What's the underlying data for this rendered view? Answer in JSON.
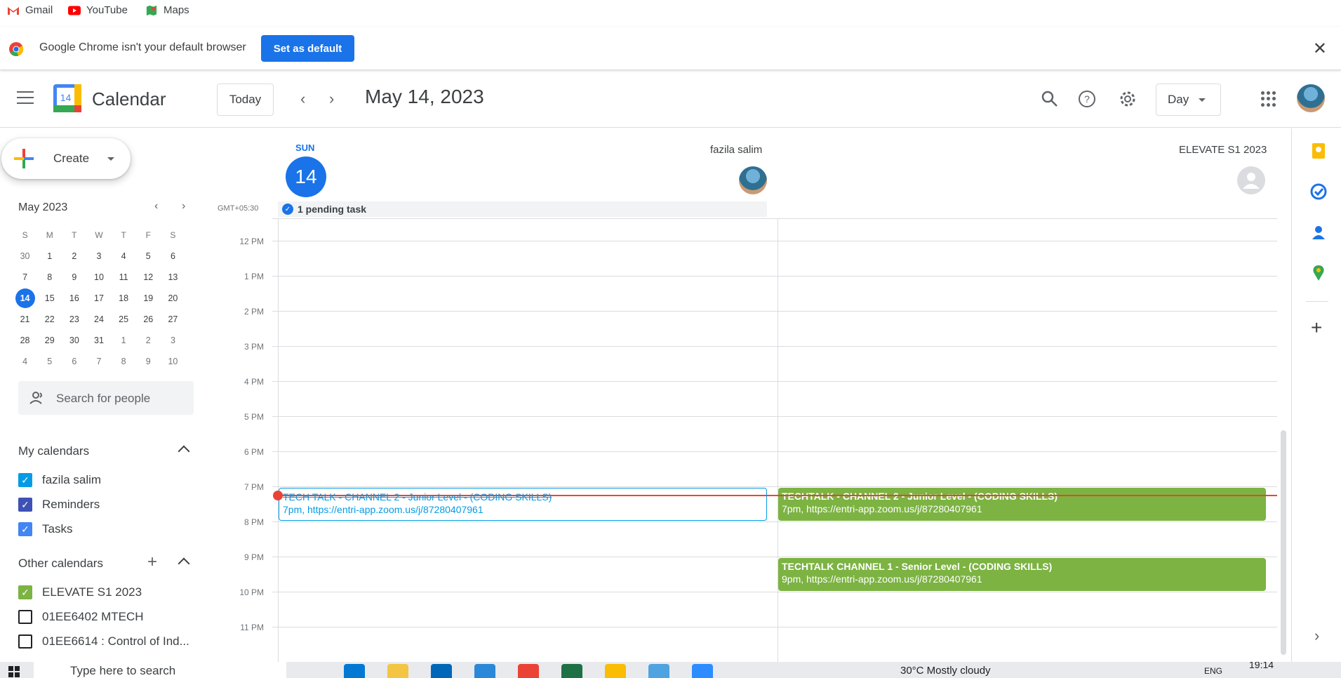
{
  "bookmarks": [
    {
      "label": "Gmail",
      "icon": "gmail-icon"
    },
    {
      "label": "YouTube",
      "icon": "youtube-icon"
    },
    {
      "label": "Maps",
      "icon": "maps-icon"
    }
  ],
  "infobar": {
    "message": "Google Chrome isn't your default browser",
    "button": "Set as default",
    "close": "✕"
  },
  "header": {
    "app_title": "Calendar",
    "logo_day": "14",
    "today_label": "Today",
    "prev": "‹",
    "next": "›",
    "date_title": "May 14, 2023",
    "view_label": "Day"
  },
  "sidebar": {
    "create_label": "Create",
    "mini_cal": {
      "title": "May 2023",
      "weekdays": [
        "S",
        "M",
        "T",
        "W",
        "T",
        "F",
        "S"
      ],
      "weeks": [
        [
          "30",
          "1",
          "2",
          "3",
          "4",
          "5",
          "6"
        ],
        [
          "7",
          "8",
          "9",
          "10",
          "11",
          "12",
          "13"
        ],
        [
          "14",
          "15",
          "16",
          "17",
          "18",
          "19",
          "20"
        ],
        [
          "21",
          "22",
          "23",
          "24",
          "25",
          "26",
          "27"
        ],
        [
          "28",
          "29",
          "30",
          "31",
          "1",
          "2",
          "3"
        ],
        [
          "4",
          "5",
          "6",
          "7",
          "8",
          "9",
          "10"
        ]
      ],
      "selected": "14"
    },
    "people_search_placeholder": "Search for people",
    "my_calendars_title": "My calendars",
    "my_calendars": [
      {
        "label": "fazila salim",
        "color": "#039be5",
        "checked": true
      },
      {
        "label": "Reminders",
        "color": "#3f51b5",
        "checked": true
      },
      {
        "label": "Tasks",
        "color": "#4285f4",
        "checked": true
      }
    ],
    "other_calendars_title": "Other calendars",
    "other_calendars": [
      {
        "label": "ELEVATE S1 2023",
        "color": "#7cb342",
        "checked": true
      },
      {
        "label": "01EE6402 MTECH",
        "color": "#202124",
        "checked": false
      },
      {
        "label": "01EE6614 : Control of Ind...",
        "color": "#202124",
        "checked": false
      }
    ]
  },
  "main": {
    "dow": "SUN",
    "day": "14",
    "columns": [
      "fazila salim",
      "ELEVATE S1 2023"
    ],
    "timezone": "GMT+05:30",
    "pending_task": "1 pending task",
    "hours": [
      "12 PM",
      "1 PM",
      "2 PM",
      "3 PM",
      "4 PM",
      "5 PM",
      "6 PM",
      "7 PM",
      "8 PM",
      "9 PM",
      "10 PM",
      "11 PM"
    ],
    "events": [
      {
        "title": "TECH TALK - CHANNEL 2 - Junior Level - (CODING SKILLS)",
        "detail": "7pm, https://entri-app.zoom.us/j/87280407961"
      },
      {
        "title": "TECHTALK - CHANNEL 2 - Junior Level - (CODING SKILLS)",
        "detail": "7pm, https://entri-app.zoom.us/j/87280407961"
      },
      {
        "title": "TECHTALK CHANNEL 1 - Senior Level - (CODING SKILLS)",
        "detail": "9pm, https://entri-app.zoom.us/j/87280407961"
      }
    ]
  },
  "taskbar": {
    "search_placeholder": "Type here to search",
    "weather": "30°C  Mostly cloudy",
    "lang": "ENG",
    "time": "19:14"
  }
}
